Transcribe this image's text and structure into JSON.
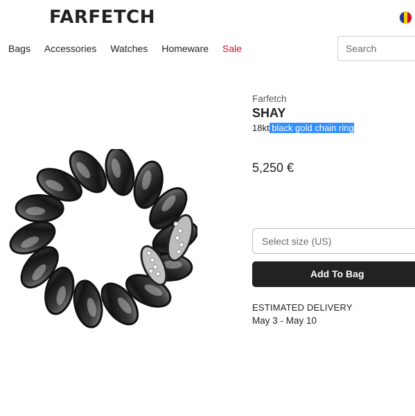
{
  "header": {
    "logo": "FARFETCH",
    "flag_icon": "country-flag-icon",
    "flag_colors": [
      "#1d3a8f",
      "#f5d200",
      "#c8102e"
    ]
  },
  "nav": {
    "items": [
      "Bags",
      "Accessories",
      "Watches",
      "Homeware",
      "Sale"
    ],
    "sale_color": "#d0102e"
  },
  "search": {
    "placeholder": "Search"
  },
  "product": {
    "brand": "Farfetch",
    "designer": "SHAY",
    "description_prefix": "18kt",
    "description_selected": " black gold chain ring",
    "price": "5,250 €",
    "image_icon": "chain-ring-image"
  },
  "size_select": {
    "placeholder": "Select size (US)"
  },
  "add_to_bag": {
    "label": "Add To Bag"
  },
  "delivery": {
    "label": "ESTIMATED DELIVERY",
    "dates": "May 3 - May 10"
  },
  "colors": {
    "selection": "#3390ff",
    "button": "#222222"
  }
}
